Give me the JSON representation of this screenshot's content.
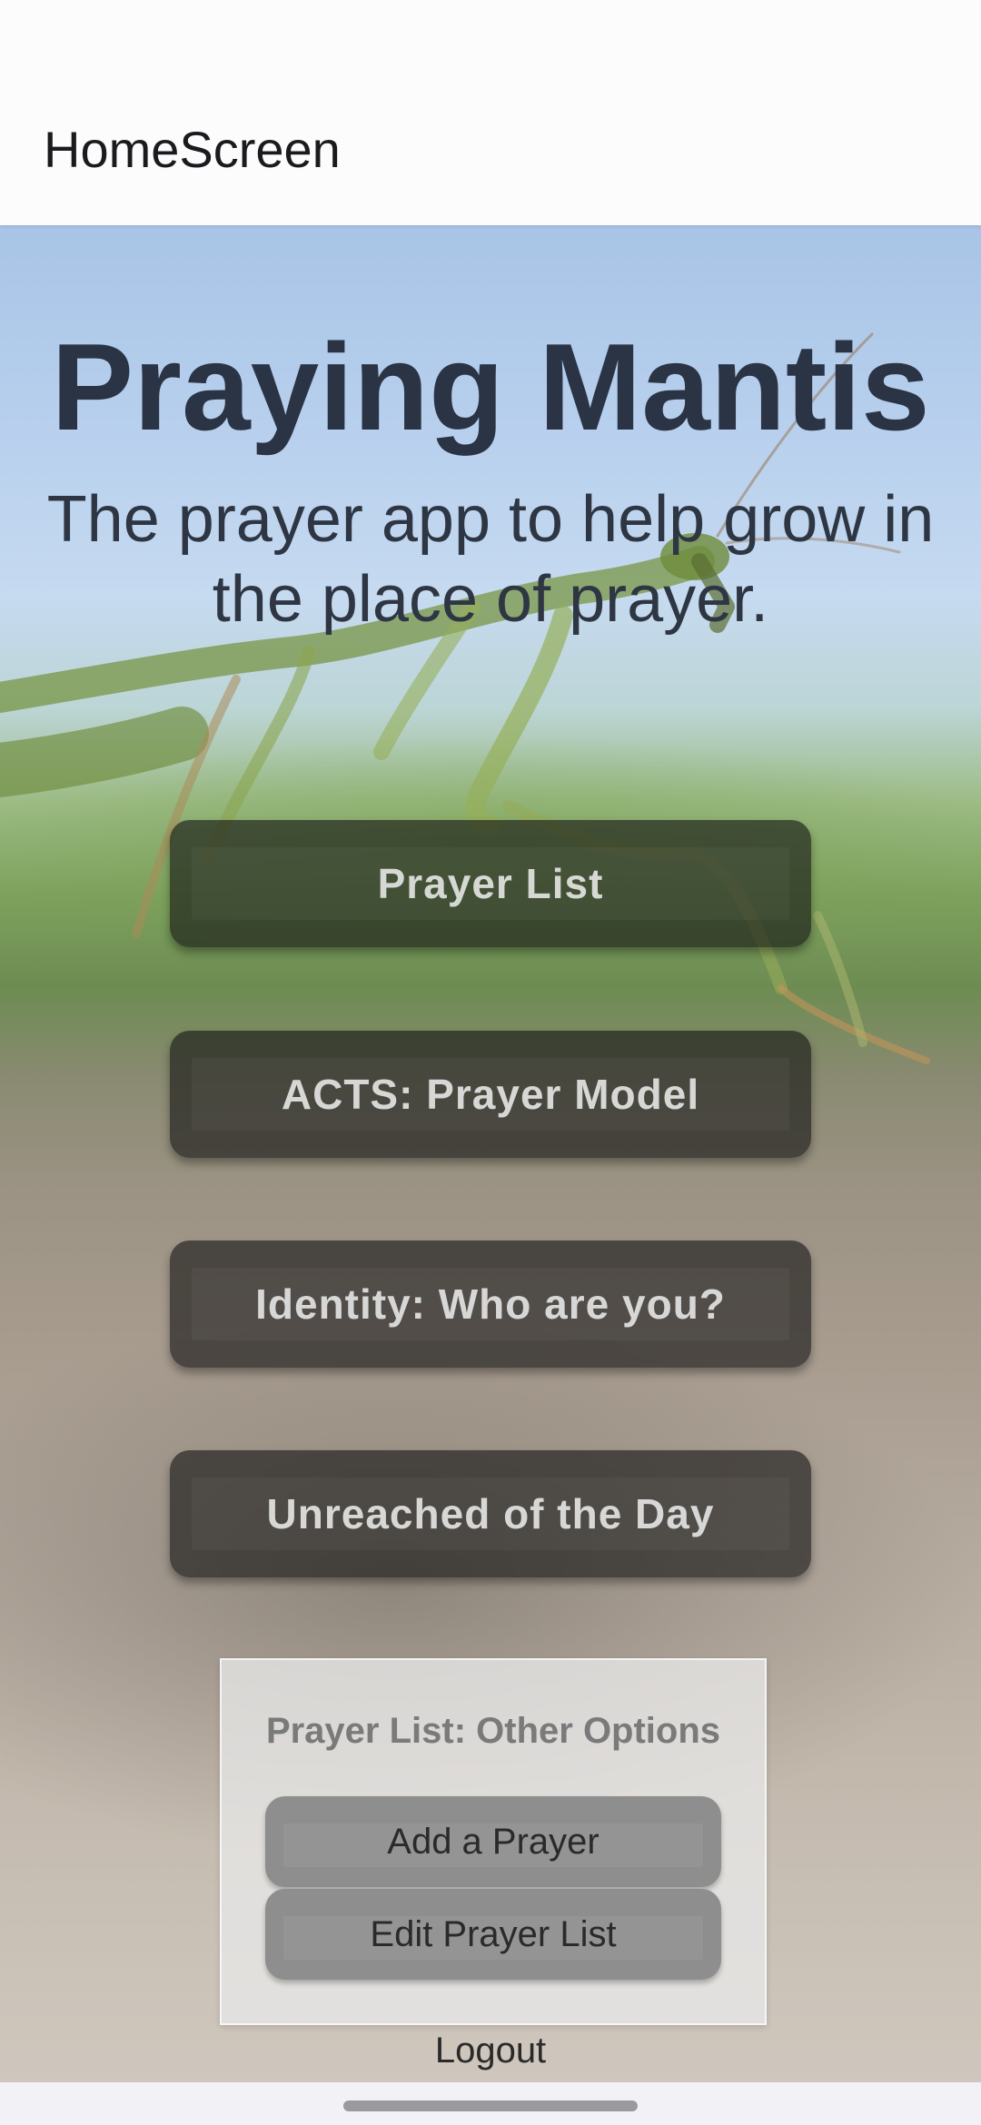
{
  "app_bar": {
    "title": "HomeScreen"
  },
  "hero": {
    "title": "Praying Mantis",
    "subtitle": "The prayer app to help grow in the place of prayer."
  },
  "main_buttons": [
    {
      "label": "Prayer List"
    },
    {
      "label": "ACTS: Prayer Model"
    },
    {
      "label": "Identity: Who are you?"
    },
    {
      "label": "Unreached of the Day"
    }
  ],
  "options_card": {
    "title": "Prayer List: Other Options",
    "buttons": [
      {
        "label": "Add a Prayer"
      },
      {
        "label": "Edit Prayer List"
      }
    ]
  },
  "logout": {
    "label": "Logout"
  },
  "colors": {
    "title_text": "#2b3445",
    "main_button_bg": "#141414",
    "option_button_bg": "#8e8e8e",
    "card_bg": "#e8e8e8"
  },
  "icons": {
    "background": "praying-mantis-photo"
  }
}
